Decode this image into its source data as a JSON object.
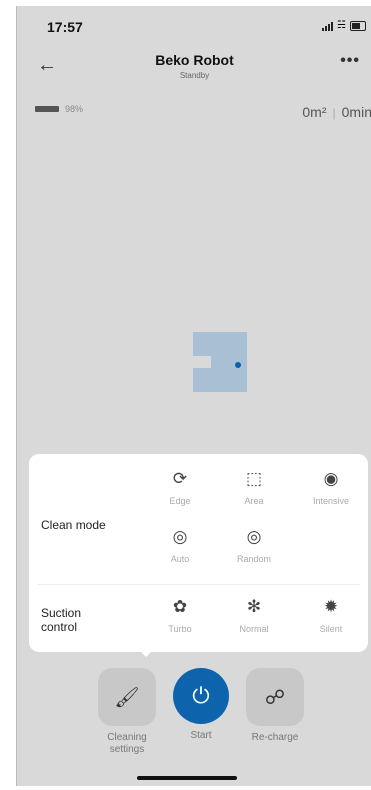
{
  "status_bar": {
    "time": "17:57"
  },
  "header": {
    "title": "Beko Robot",
    "subtitle": "Standby",
    "back_icon": "arrow-left-icon",
    "more_icon": "more-dots-icon"
  },
  "robot": {
    "battery": "98%",
    "area": "0m²",
    "time": "0min"
  },
  "panel": {
    "clean_mode_label": "Clean mode",
    "clean_modes": [
      {
        "label": "Edge",
        "icon": "edge-icon"
      },
      {
        "label": "Area",
        "icon": "area-icon"
      },
      {
        "label": "Intensive",
        "icon": "intensive-icon"
      },
      {
        "label": "Auto",
        "icon": "auto-icon"
      },
      {
        "label": "Random",
        "icon": "random-icon"
      }
    ],
    "suction_label": "Suction control",
    "suction_levels": [
      {
        "label": "Turbo",
        "icon": "fan-turbo-icon"
      },
      {
        "label": "Normal",
        "icon": "fan-normal-icon"
      },
      {
        "label": "Silent",
        "icon": "fan-silent-icon"
      }
    ]
  },
  "bottom": {
    "cleaning_settings": "Cleaning settings",
    "start": "Start",
    "recharge": "Re-charge"
  },
  "colors": {
    "accent": "#0d64ad",
    "map_area": "#a9bfd4",
    "background": "#d9d9d9"
  }
}
